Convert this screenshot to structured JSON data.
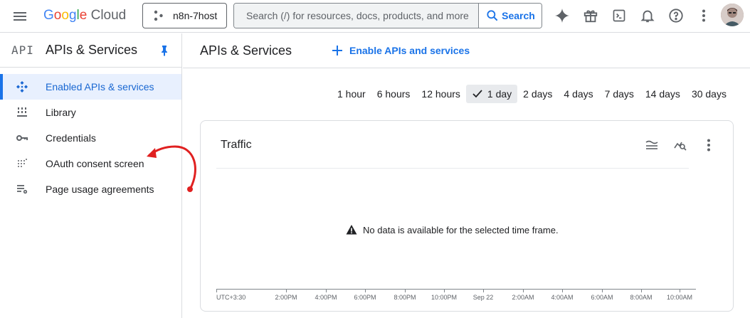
{
  "topbar": {
    "logo_google": "Google",
    "logo_cloud": "Cloud",
    "project": "n8n-7host",
    "search_placeholder": "Search (/) for resources, docs, products, and more",
    "search_button": "Search",
    "icons": [
      "menu-icon",
      "project-icon",
      "search-icon",
      "gemini-icon",
      "gift-icon",
      "terminal-icon",
      "bell-icon",
      "help-icon",
      "more-vert-icon",
      "avatar"
    ]
  },
  "sidebar": {
    "badge": "API",
    "title": "APIs & Services",
    "items": [
      {
        "label": "Enabled APIs & services",
        "icon": "enabled-apis-icon",
        "active": true
      },
      {
        "label": "Library",
        "icon": "library-icon",
        "active": false
      },
      {
        "label": "Credentials",
        "icon": "key-icon",
        "active": false
      },
      {
        "label": "OAuth consent screen",
        "icon": "oauth-icon",
        "active": false
      },
      {
        "label": "Page usage agreements",
        "icon": "settings-list-icon",
        "active": false
      }
    ]
  },
  "main": {
    "title": "APIs & Services",
    "enable_button": "Enable APIs and services",
    "time_ranges": [
      "1 hour",
      "6 hours",
      "12 hours",
      "1 day",
      "2 days",
      "4 days",
      "7 days",
      "14 days",
      "30 days"
    ],
    "selected_range": "1 day"
  },
  "card": {
    "title": "Traffic",
    "no_data": "No data is available for the selected time frame.",
    "x_ticks": [
      "UTC+3:30",
      "2:00PM",
      "4:00PM",
      "6:00PM",
      "8:00PM",
      "10:00PM",
      "Sep 22",
      "2:00AM",
      "4:00AM",
      "6:00AM",
      "8:00AM",
      "10:00AM"
    ]
  },
  "colors": {
    "accent": "#1a73e8",
    "active_bg": "#e8f0fe",
    "annotation": "#e02020"
  }
}
